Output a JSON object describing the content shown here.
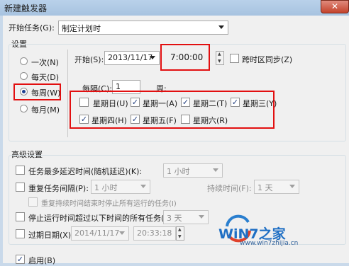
{
  "window": {
    "title": "新建触发器",
    "close_glyph": "✕"
  },
  "begin_task": {
    "label": "开始任务(G):",
    "value": "制定计划时"
  },
  "settings": {
    "label": "设置",
    "radios": [
      {
        "label": "一次(N)",
        "selected": false
      },
      {
        "label": "每天(D)",
        "selected": false
      },
      {
        "label": "每周(W)",
        "selected": true
      },
      {
        "label": "每月(M)",
        "selected": false
      }
    ],
    "start_label": "开始(S):",
    "start_date": "2013/11/17",
    "start_time": "7:00:00",
    "sync_label": "跨时区同步(Z)",
    "every_label": "每隔(C):",
    "every_value": "1",
    "week_label": "周:",
    "days": [
      {
        "label": "星期日(U)",
        "checked": false
      },
      {
        "label": "星期一(A)",
        "checked": true
      },
      {
        "label": "星期二(T)",
        "checked": true
      },
      {
        "label": "星期三(Y)",
        "checked": true
      },
      {
        "label": "星期四(H)",
        "checked": true
      },
      {
        "label": "星期五(F)",
        "checked": true
      },
      {
        "label": "星期六(R)",
        "checked": false
      }
    ]
  },
  "advanced": {
    "label": "高级设置",
    "delay_label": "任务最多延迟时间(随机延迟)(K):",
    "delay_value": "1 小时",
    "repeat_label": "重复任务间隔(P):",
    "repeat_value": "1 小时",
    "duration_label": "持续时间(F):",
    "duration_value": "1 天",
    "stop_at_end_label": "重复持续时间结束时停止所有运行的任务(I)",
    "stop_longer_label": "停止运行时间超过以下时间的所有任务(L):",
    "stop_longer_value": "3 天",
    "expire_label": "过期日期(X):",
    "expire_date": "2014/11/17",
    "expire_time": "20:33:18",
    "enabled_label": "启用(B)"
  },
  "watermark": {
    "brand": "WiN7之家",
    "url": "www.win7zhijia.cn"
  },
  "colors": {
    "highlight": "#e20f10",
    "title_bar": "#b9d1ea",
    "close": "#c4432c"
  }
}
